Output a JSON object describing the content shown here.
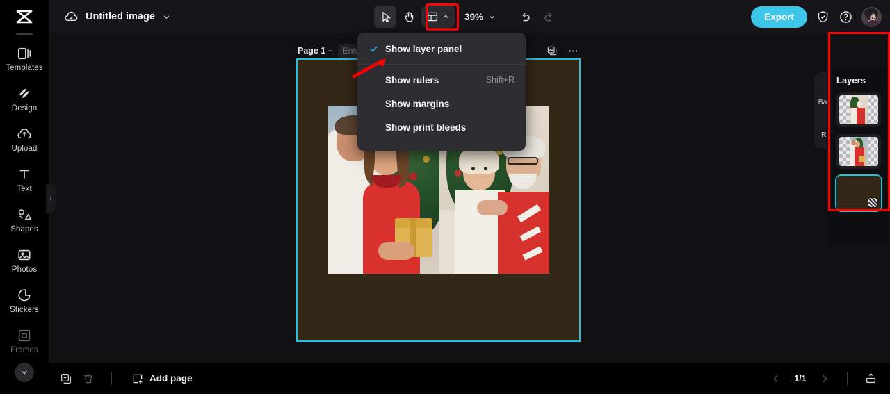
{
  "app": {
    "logo_icon": "capcut-logo-icon",
    "cloud_icon": "cloud-saved-icon",
    "doc_title": "Untitled image",
    "doc_chevron_icon": "chevron-down-icon"
  },
  "toolbar": {
    "select_tool_icon": "cursor-select-icon",
    "hand_tool_icon": "hand-pan-icon",
    "view_options_icon": "layout-view-icon",
    "view_options_chevron_icon": "chevron-up-icon",
    "zoom_value": "39%",
    "zoom_chevron_icon": "chevron-down-icon",
    "undo_icon": "undo-icon",
    "redo_icon": "redo-icon",
    "export_label": "Export",
    "shield_icon": "shield-check-icon",
    "help_icon": "question-circle-icon",
    "avatar_icon": "user-avatar"
  },
  "sidebar": {
    "items": [
      {
        "label": "Templates",
        "icon": "templates-icon",
        "dim": false
      },
      {
        "label": "Design",
        "icon": "design-icon",
        "dim": false
      },
      {
        "label": "Upload",
        "icon": "upload-cloud-icon",
        "dim": false
      },
      {
        "label": "Text",
        "icon": "text-icon",
        "dim": false
      },
      {
        "label": "Shapes",
        "icon": "shapes-icon",
        "dim": false
      },
      {
        "label": "Photos",
        "icon": "photos-icon",
        "dim": false
      },
      {
        "label": "Stickers",
        "icon": "stickers-icon",
        "dim": false
      },
      {
        "label": "Frames",
        "icon": "frames-icon",
        "dim": true
      }
    ],
    "more_icon": "chevron-down-icon",
    "expand_handle_icon": "chevron-right-icon"
  },
  "view_menu": {
    "items": [
      {
        "label": "Show layer panel",
        "shortcut": "",
        "checked": true
      },
      {
        "label": "Show rulers",
        "shortcut": "Shift+R",
        "checked": false
      },
      {
        "label": "Show margins",
        "shortcut": "",
        "checked": false
      },
      {
        "label": "Show print bleeds",
        "shortcut": "",
        "checked": false
      }
    ],
    "check_icon": "check-icon"
  },
  "canvas": {
    "page_label": "Page 1 –",
    "page_name_placeholder": "Enter page name",
    "page_name_value": "",
    "duplicate_page_icon": "duplicate-page-icon",
    "more_options_icon": "more-horizontal-icon",
    "background_color": "#332716",
    "selection_color": "#23c0e0"
  },
  "float_tools": {
    "items": [
      {
        "label": "Backgr...",
        "icon": "background-pattern-icon"
      },
      {
        "label": "Resize",
        "icon": "resize-icon"
      }
    ]
  },
  "layers": {
    "title": "Layers",
    "highlight_color": "#ff0000",
    "items": [
      {
        "name": "photo-layer-grandparents",
        "type": "image",
        "selected": false
      },
      {
        "name": "photo-layer-couple",
        "type": "image",
        "selected": false
      },
      {
        "name": "background-layer",
        "type": "background",
        "selected": true,
        "badge_icon": "background-swatch-icon"
      }
    ]
  },
  "bottom_bar": {
    "duplicate_icon": "duplicate-icon",
    "delete_icon": "trash-icon",
    "add_page_icon": "add-page-icon",
    "add_page_label": "Add page",
    "prev_page_icon": "chevron-left-icon",
    "page_counter": "1/1",
    "next_page_icon": "chevron-right-icon",
    "present_icon": "present-upload-icon"
  }
}
